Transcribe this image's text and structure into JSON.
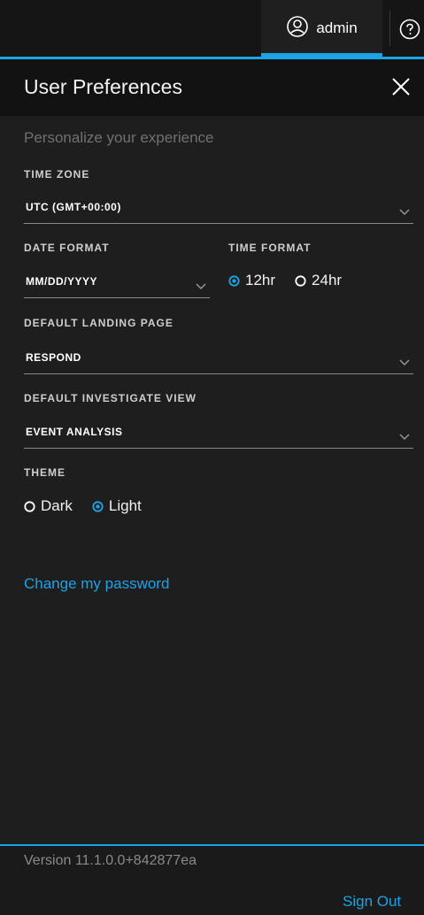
{
  "topbar": {
    "user_label": "admin",
    "user_icon": "user-circle-icon",
    "help_icon": "help-circle-icon"
  },
  "panel": {
    "title": "User Preferences",
    "close_icon": "close-icon",
    "subtitle": "Personalize your experience"
  },
  "time_zone": {
    "label": "TIME ZONE",
    "value": "UTC (GMT+00:00)"
  },
  "date_format": {
    "label": "DATE FORMAT",
    "value": "MM/DD/YYYY"
  },
  "time_format": {
    "label": "TIME FORMAT",
    "options": [
      "12hr",
      "24hr"
    ],
    "selected": "12hr"
  },
  "landing_page": {
    "label": "DEFAULT LANDING PAGE",
    "value": "RESPOND"
  },
  "investigate_view": {
    "label": "DEFAULT INVESTIGATE VIEW",
    "value": "EVENT ANALYSIS"
  },
  "theme": {
    "label": "THEME",
    "options": [
      "Dark",
      "Light"
    ],
    "selected": "Light"
  },
  "change_password": "Change my password",
  "footer": {
    "version": "Version 11.1.0.0+842877ea",
    "sign_out": "Sign Out"
  },
  "colors": {
    "accent": "#1ba3e8",
    "background": "#1e1e1e",
    "header": "#121212"
  }
}
